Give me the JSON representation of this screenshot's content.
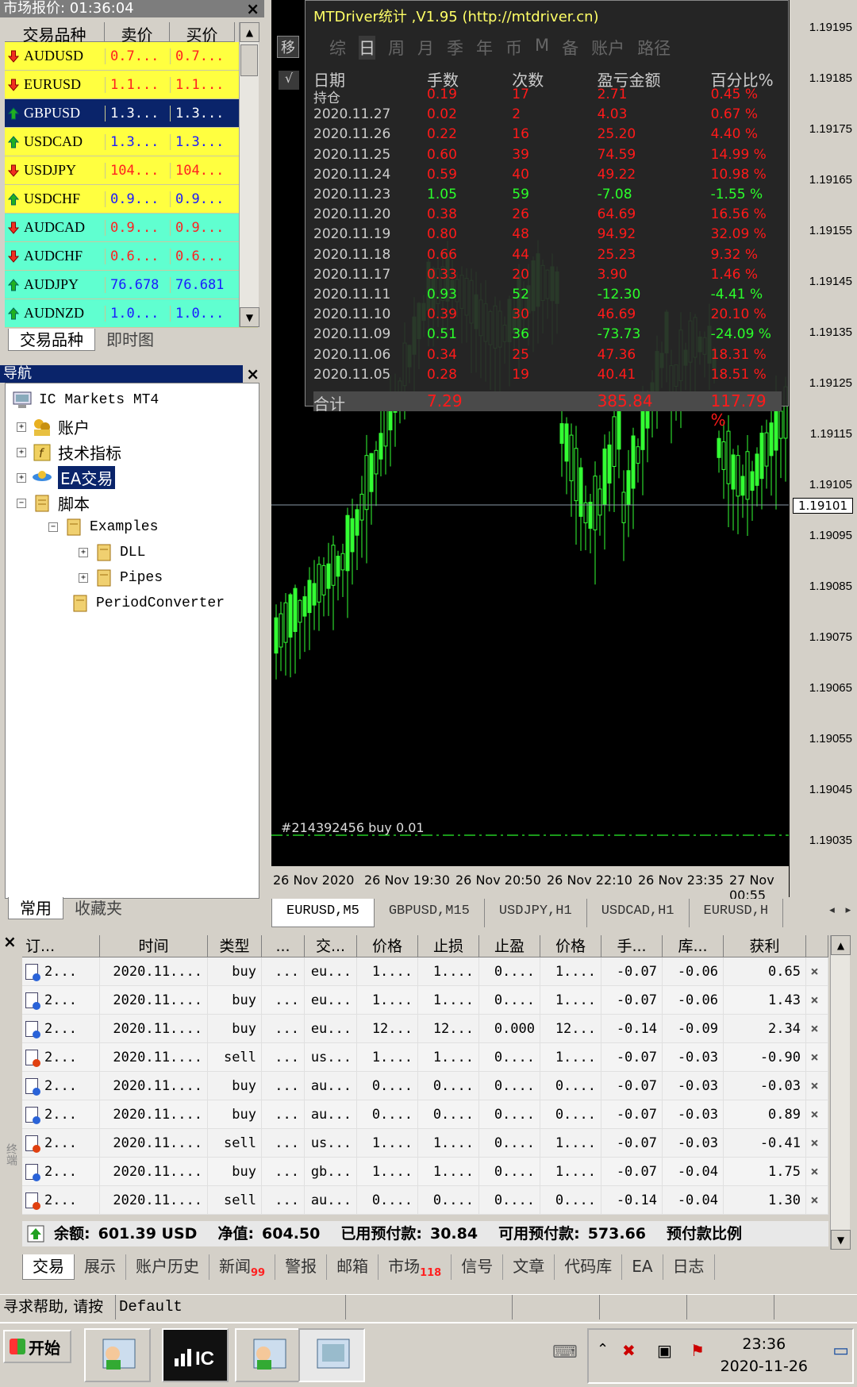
{
  "market_watch": {
    "title": "市场报价: 01:36:04",
    "headers": [
      "交易品种",
      "卖价",
      "买价"
    ],
    "rows": [
      {
        "symbol": "AUDUSD",
        "bid": "0.7...",
        "ask": "0.7...",
        "dir": "down",
        "bg": "#ffff40",
        "price_color": "#ff2020"
      },
      {
        "symbol": "EURUSD",
        "bid": "1.1...",
        "ask": "1.1...",
        "dir": "down",
        "bg": "#ffff40",
        "price_color": "#ff2020"
      },
      {
        "symbol": "GBPUSD",
        "bid": "1.3...",
        "ask": "1.3...",
        "dir": "up",
        "bg": "#0a246a",
        "price_color": "#ffffff"
      },
      {
        "symbol": "USDCAD",
        "bid": "1.3...",
        "ask": "1.3...",
        "dir": "up",
        "bg": "#ffff40",
        "price_color": "#1a1aff"
      },
      {
        "symbol": "USDJPY",
        "bid": "104...",
        "ask": "104...",
        "dir": "down",
        "bg": "#ffff40",
        "price_color": "#ff2020"
      },
      {
        "symbol": "USDCHF",
        "bid": "0.9...",
        "ask": "0.9...",
        "dir": "up",
        "bg": "#ffff40",
        "price_color": "#1a1aff"
      },
      {
        "symbol": "AUDCAD",
        "bid": "0.9...",
        "ask": "0.9...",
        "dir": "down",
        "bg": "#60ffd0",
        "price_color": "#ff2020"
      },
      {
        "symbol": "AUDCHF",
        "bid": "0.6...",
        "ask": "0.6...",
        "dir": "down",
        "bg": "#60ffd0",
        "price_color": "#ff2020"
      },
      {
        "symbol": "AUDJPY",
        "bid": "76.678",
        "ask": "76.681",
        "dir": "up",
        "bg": "#60ffd0",
        "price_color": "#1a1aff"
      },
      {
        "symbol": "AUDNZD",
        "bid": "1.0...",
        "ask": "1.0...",
        "dir": "up",
        "bg": "#60ffd0",
        "price_color": "#1a1aff"
      }
    ],
    "tabs": [
      "交易品种",
      "即时图"
    ]
  },
  "navigator": {
    "title": "导航",
    "root": "IC Markets MT4",
    "items": [
      "账户",
      "技术指标",
      "EA交易",
      "脚本"
    ],
    "scripts": [
      "Examples",
      "DLL",
      "Pipes",
      "PeriodConverter"
    ],
    "tabs": [
      "常用",
      "收藏夹"
    ]
  },
  "stats_panel": {
    "title": "MTDriver统计 ,V1.95 (http://mtdriver.cn)",
    "move_button": "移",
    "check_button": "√",
    "periods": [
      "综",
      "日",
      "周",
      "月",
      "季",
      "年",
      "币",
      "M",
      "备",
      "账户",
      "路径"
    ],
    "active_period": "日",
    "headers": [
      "日期",
      "手数",
      "次数",
      "盈亏金额",
      "百分比%"
    ],
    "rows": [
      {
        "date": "持仓",
        "lots": "0.19",
        "count": "17",
        "pnl": "2.71",
        "pct": "0.45 %",
        "sign": "pos"
      },
      {
        "date": "2020.11.27",
        "lots": "0.02",
        "count": "2",
        "pnl": "4.03",
        "pct": "0.67 %",
        "sign": "pos"
      },
      {
        "date": "2020.11.26",
        "lots": "0.22",
        "count": "16",
        "pnl": "25.20",
        "pct": "4.40 %",
        "sign": "pos"
      },
      {
        "date": "2020.11.25",
        "lots": "0.60",
        "count": "39",
        "pnl": "74.59",
        "pct": "14.99 %",
        "sign": "pos"
      },
      {
        "date": "2020.11.24",
        "lots": "0.59",
        "count": "40",
        "pnl": "49.22",
        "pct": "10.98 %",
        "sign": "pos"
      },
      {
        "date": "2020.11.23",
        "lots": "1.05",
        "count": "59",
        "pnl": "-7.08",
        "pct": "-1.55 %",
        "sign": "neg"
      },
      {
        "date": "2020.11.20",
        "lots": "0.38",
        "count": "26",
        "pnl": "64.69",
        "pct": "16.56 %",
        "sign": "pos"
      },
      {
        "date": "2020.11.19",
        "lots": "0.80",
        "count": "48",
        "pnl": "94.92",
        "pct": "32.09 %",
        "sign": "pos"
      },
      {
        "date": "2020.11.18",
        "lots": "0.66",
        "count": "44",
        "pnl": "25.23",
        "pct": "9.32 %",
        "sign": "pos"
      },
      {
        "date": "2020.11.17",
        "lots": "0.33",
        "count": "20",
        "pnl": "3.90",
        "pct": "1.46 %",
        "sign": "pos"
      },
      {
        "date": "2020.11.11",
        "lots": "0.93",
        "count": "52",
        "pnl": "-12.30",
        "pct": "-4.41 %",
        "sign": "neg"
      },
      {
        "date": "2020.11.10",
        "lots": "0.39",
        "count": "30",
        "pnl": "46.69",
        "pct": "20.10 %",
        "sign": "pos"
      },
      {
        "date": "2020.11.09",
        "lots": "0.51",
        "count": "36",
        "pnl": "-73.73",
        "pct": "-24.09 %",
        "sign": "neg"
      },
      {
        "date": "2020.11.06",
        "lots": "0.34",
        "count": "25",
        "pnl": "47.36",
        "pct": "18.31 %",
        "sign": "pos"
      },
      {
        "date": "2020.11.05",
        "lots": "0.28",
        "count": "19",
        "pnl": "40.41",
        "pct": "18.51 %",
        "sign": "pos"
      },
      {
        "date": "合计",
        "lots": "7.29",
        "count": "",
        "pnl": "385.84",
        "pct": "117.79 %",
        "sign": "pos"
      }
    ]
  },
  "chart": {
    "price_labels": [
      "1.19195",
      "1.19185",
      "1.19175",
      "1.19165",
      "1.19155",
      "1.19145",
      "1.19135",
      "1.19125",
      "1.19115",
      "1.19105",
      "1.19095",
      "1.19085",
      "1.19075",
      "1.19065",
      "1.19055",
      "1.19045",
      "1.19035"
    ],
    "current_price": "1.19101",
    "time_labels": [
      "26 Nov 2020",
      "26 Nov 19:30",
      "26 Nov 20:50",
      "26 Nov 22:10",
      "26 Nov 23:35",
      "27 Nov 00:55"
    ],
    "order_label": "#214392456 buy 0.01",
    "candle_color": "#33ff33",
    "tabs": [
      "EURUSD,M5",
      "GBPUSD,M15",
      "USDJPY,H1",
      "USDCAD,H1",
      "EURUSD,H"
    ]
  },
  "terminal": {
    "headers": [
      "订...",
      "时间",
      "类型",
      "...",
      "交...",
      "价格",
      "止损",
      "止盈",
      "价格",
      "手...",
      "库...",
      "获利",
      ""
    ],
    "rows": [
      {
        "ticket": "2...",
        "time": "2020.11....",
        "type": "buy",
        "size": "...",
        "symbol": "eu...",
        "price": "1....",
        "sl": "1....",
        "tp": "0....",
        "cur": "1....",
        "comm": "-0.07",
        "swap": "-0.06",
        "profit": "0.65"
      },
      {
        "ticket": "2...",
        "time": "2020.11....",
        "type": "buy",
        "size": "...",
        "symbol": "eu...",
        "price": "1....",
        "sl": "1....",
        "tp": "0....",
        "cur": "1....",
        "comm": "-0.07",
        "swap": "-0.06",
        "profit": "1.43"
      },
      {
        "ticket": "2...",
        "time": "2020.11....",
        "type": "buy",
        "size": "...",
        "symbol": "eu...",
        "price": "12...",
        "sl": "12...",
        "tp": "0.000",
        "cur": "12...",
        "comm": "-0.14",
        "swap": "-0.09",
        "profit": "2.34"
      },
      {
        "ticket": "2...",
        "time": "2020.11....",
        "type": "sell",
        "size": "...",
        "symbol": "us...",
        "price": "1....",
        "sl": "1....",
        "tp": "0....",
        "cur": "1....",
        "comm": "-0.07",
        "swap": "-0.03",
        "profit": "-0.90"
      },
      {
        "ticket": "2...",
        "time": "2020.11....",
        "type": "buy",
        "size": "...",
        "symbol": "au...",
        "price": "0....",
        "sl": "0....",
        "tp": "0....",
        "cur": "0....",
        "comm": "-0.07",
        "swap": "-0.03",
        "profit": "-0.03"
      },
      {
        "ticket": "2...",
        "time": "2020.11....",
        "type": "buy",
        "size": "...",
        "symbol": "au...",
        "price": "0....",
        "sl": "0....",
        "tp": "0....",
        "cur": "0....",
        "comm": "-0.07",
        "swap": "-0.03",
        "profit": "0.89"
      },
      {
        "ticket": "2...",
        "time": "2020.11....",
        "type": "sell",
        "size": "...",
        "symbol": "us...",
        "price": "1....",
        "sl": "1....",
        "tp": "0....",
        "cur": "1....",
        "comm": "-0.07",
        "swap": "-0.03",
        "profit": "-0.41"
      },
      {
        "ticket": "2...",
        "time": "2020.11....",
        "type": "buy",
        "size": "...",
        "symbol": "gb...",
        "price": "1....",
        "sl": "1....",
        "tp": "0....",
        "cur": "1....",
        "comm": "-0.07",
        "swap": "-0.04",
        "profit": "1.75"
      },
      {
        "ticket": "2...",
        "time": "2020.11....",
        "type": "sell",
        "size": "...",
        "symbol": "au...",
        "price": "0....",
        "sl": "0....",
        "tp": "0....",
        "cur": "0....",
        "comm": "-0.14",
        "swap": "-0.04",
        "profit": "1.30"
      }
    ],
    "delete_glyph": "×",
    "balance": {
      "balance_label": "余额:",
      "balance_value": "601.39 USD",
      "equity_label": "净值:",
      "equity_value": "604.50",
      "margin_label": "已用预付款:",
      "margin_value": "30.84",
      "free_label": "可用预付款:",
      "free_value": "573.66",
      "level_label": "预付款比例"
    },
    "tabs": [
      {
        "label": "交易",
        "badge": ""
      },
      {
        "label": "展示",
        "badge": ""
      },
      {
        "label": "账户历史",
        "badge": ""
      },
      {
        "label": "新闻",
        "badge": "99"
      },
      {
        "label": "警报",
        "badge": ""
      },
      {
        "label": "邮箱",
        "badge": ""
      },
      {
        "label": "市场",
        "badge": "118"
      },
      {
        "label": "信号",
        "badge": ""
      },
      {
        "label": "文章",
        "badge": ""
      },
      {
        "label": "代码库",
        "badge": ""
      },
      {
        "label": "EA",
        "badge": ""
      },
      {
        "label": "日志",
        "badge": ""
      }
    ],
    "side_label": "终端"
  },
  "statusbar": {
    "help": "寻求帮助, 请按",
    "profile": "Default"
  },
  "taskbar": {
    "start": "开始",
    "time": "23:36",
    "date": "2020-11-26"
  }
}
